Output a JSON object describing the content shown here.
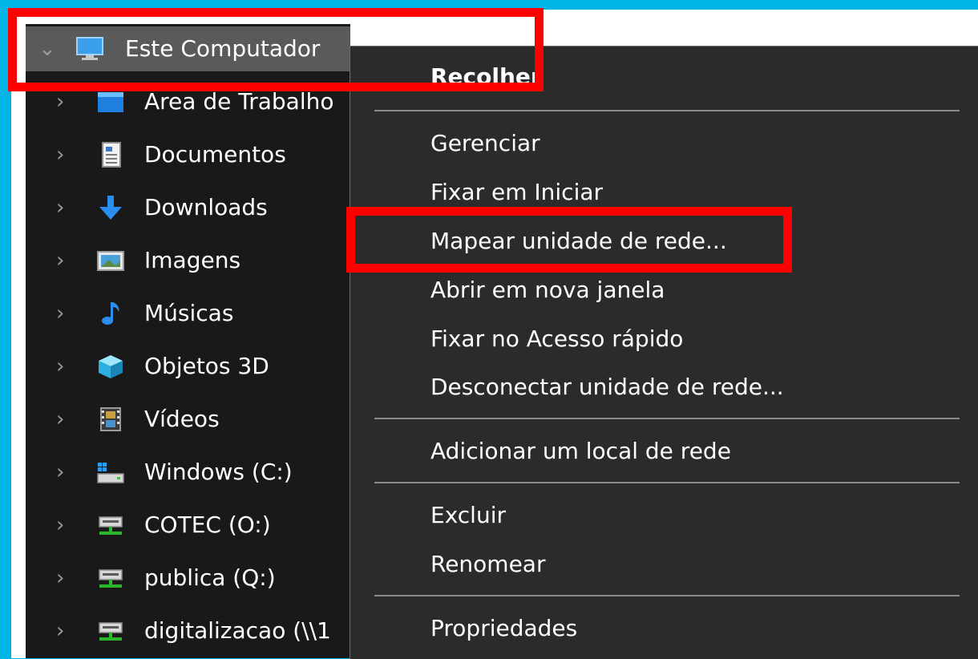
{
  "colors": {
    "outer_background": "#00b4e6",
    "nav_background": "#191919",
    "menu_background": "#2b2b2b",
    "selected_row": "#5a5a5a",
    "annotation_red": "#ff0000"
  },
  "navigation": {
    "root": {
      "label": "Este Computador",
      "icon": "computer-icon"
    },
    "items": [
      {
        "label": "Área de Trabalho",
        "icon": "desktop-icon"
      },
      {
        "label": "Documentos",
        "icon": "document-icon"
      },
      {
        "label": "Downloads",
        "icon": "download-arrow-icon"
      },
      {
        "label": "Imagens",
        "icon": "picture-icon"
      },
      {
        "label": "Músicas",
        "icon": "music-note-icon"
      },
      {
        "label": "Objetos 3D",
        "icon": "cube-icon"
      },
      {
        "label": "Vídeos",
        "icon": "film-icon"
      },
      {
        "label": "Windows  (C:)",
        "icon": "windows-drive-icon"
      },
      {
        "label": "COTEC (O:)",
        "icon": "network-drive-icon"
      },
      {
        "label": "publica (Q:)",
        "icon": "network-drive-icon"
      },
      {
        "label": "digitalizacao (\\\\1",
        "icon": "network-drive-icon"
      }
    ]
  },
  "context_menu": {
    "items": [
      {
        "label": "Recolher",
        "bold": true
      },
      {
        "label": "Gerenciar"
      },
      {
        "label": "Fixar em Iniciar"
      },
      {
        "label": "Mapear unidade de rede..."
      },
      {
        "label": "Abrir em nova janela"
      },
      {
        "label": "Fixar no Acesso rápido"
      },
      {
        "label": "Desconectar unidade de rede..."
      },
      {
        "label": "Adicionar um local de rede"
      },
      {
        "label": "Excluir"
      },
      {
        "label": "Renomear"
      },
      {
        "label": "Propriedades"
      }
    ]
  }
}
